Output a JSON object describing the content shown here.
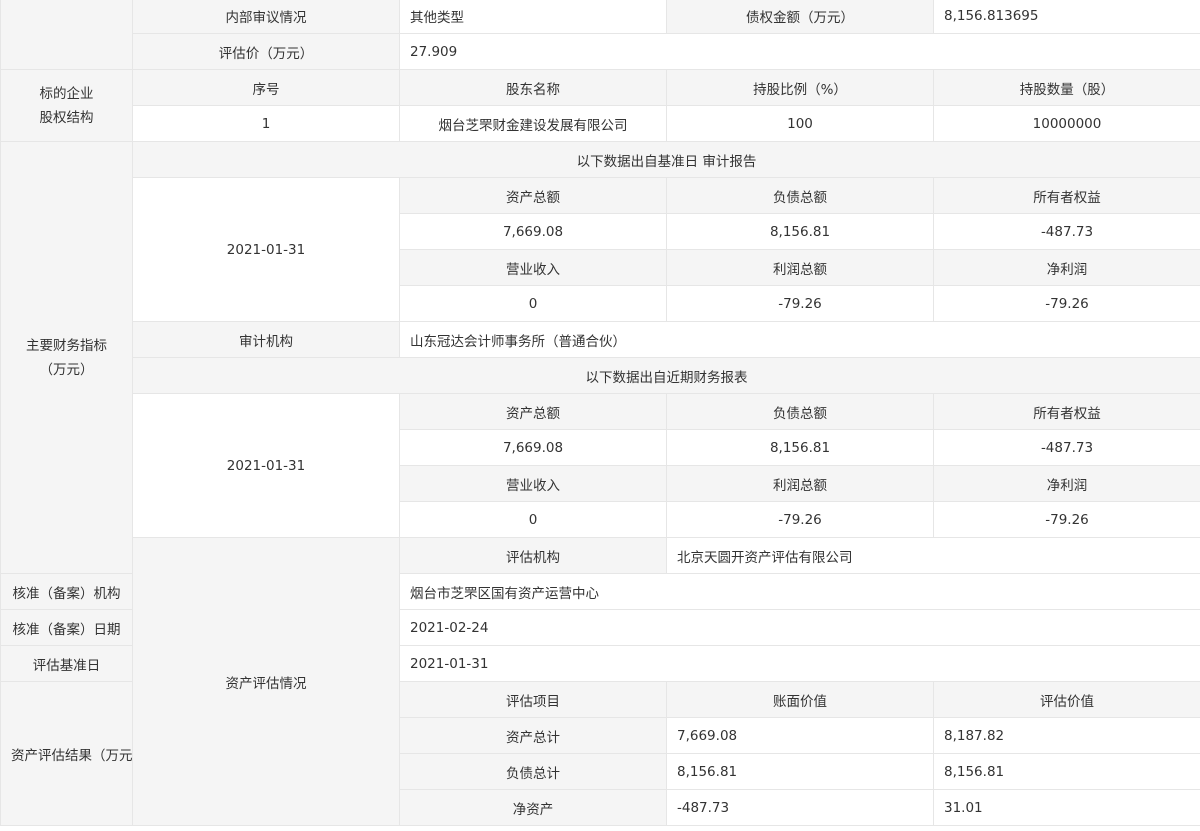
{
  "row_review": {
    "label": "内部审议情况",
    "value": "其他类型",
    "debt_label": "债权金额（万元）",
    "debt_value": "8,156.813695"
  },
  "row_price": {
    "label": "评估价（万元）",
    "value": "27.909"
  },
  "equity": {
    "section_label_line1": "标的企业",
    "section_label_line2": "股权结构",
    "headers": [
      "序号",
      "股东名称",
      "持股比例（%）",
      "持股数量（股）"
    ],
    "row": [
      "1",
      "烟台芝罘财金建设发展有限公司",
      "100",
      "10000000"
    ]
  },
  "financial": {
    "section_label_line1": "主要财务指标",
    "section_label_line2": "（万元）",
    "audit": {
      "title": "以下数据出自基准日 审计报告",
      "date": "2021-01-31",
      "headers1": [
        "资产总额",
        "负债总额",
        "所有者权益"
      ],
      "values1": [
        "7,669.08",
        "8,156.81",
        "-487.73"
      ],
      "headers2": [
        "营业收入",
        "利润总额",
        "净利润"
      ],
      "values2": [
        "0",
        "-79.26",
        "-79.26"
      ]
    },
    "audit_org_label": "审计机构",
    "audit_org_value": "山东冠达会计师事务所（普通合伙）",
    "recent": {
      "title": "以下数据出自近期财务报表",
      "date": "2021-01-31",
      "headers1": [
        "资产总额",
        "负债总额",
        "所有者权益"
      ],
      "values1": [
        "7,669.08",
        "8,156.81",
        "-487.73"
      ],
      "headers2": [
        "营业收入",
        "利润总额",
        "净利润"
      ],
      "values2": [
        "0",
        "-79.26",
        "-79.26"
      ]
    }
  },
  "asset_eval": {
    "section_label": "资产评估情况",
    "rows": [
      {
        "label": "评估机构",
        "value": "北京天圆开资产评估有限公司"
      },
      {
        "label": "核准（备案）机构",
        "value": "烟台市芝罘区国有资产运营中心"
      },
      {
        "label": "核准（备案）日期",
        "value": "2021-02-24"
      },
      {
        "label": "评估基准日",
        "value": "2021-01-31"
      }
    ],
    "result_label": "资产评估结果（万元）",
    "result_headers": [
      "评估项目",
      "账面价值",
      "评估价值"
    ],
    "result_rows": [
      [
        "资产总计",
        "7,669.08",
        "8,187.82"
      ],
      [
        "负债总计",
        "8,156.81",
        "8,156.81"
      ],
      [
        "净资产",
        "-487.73",
        "31.01"
      ]
    ]
  }
}
